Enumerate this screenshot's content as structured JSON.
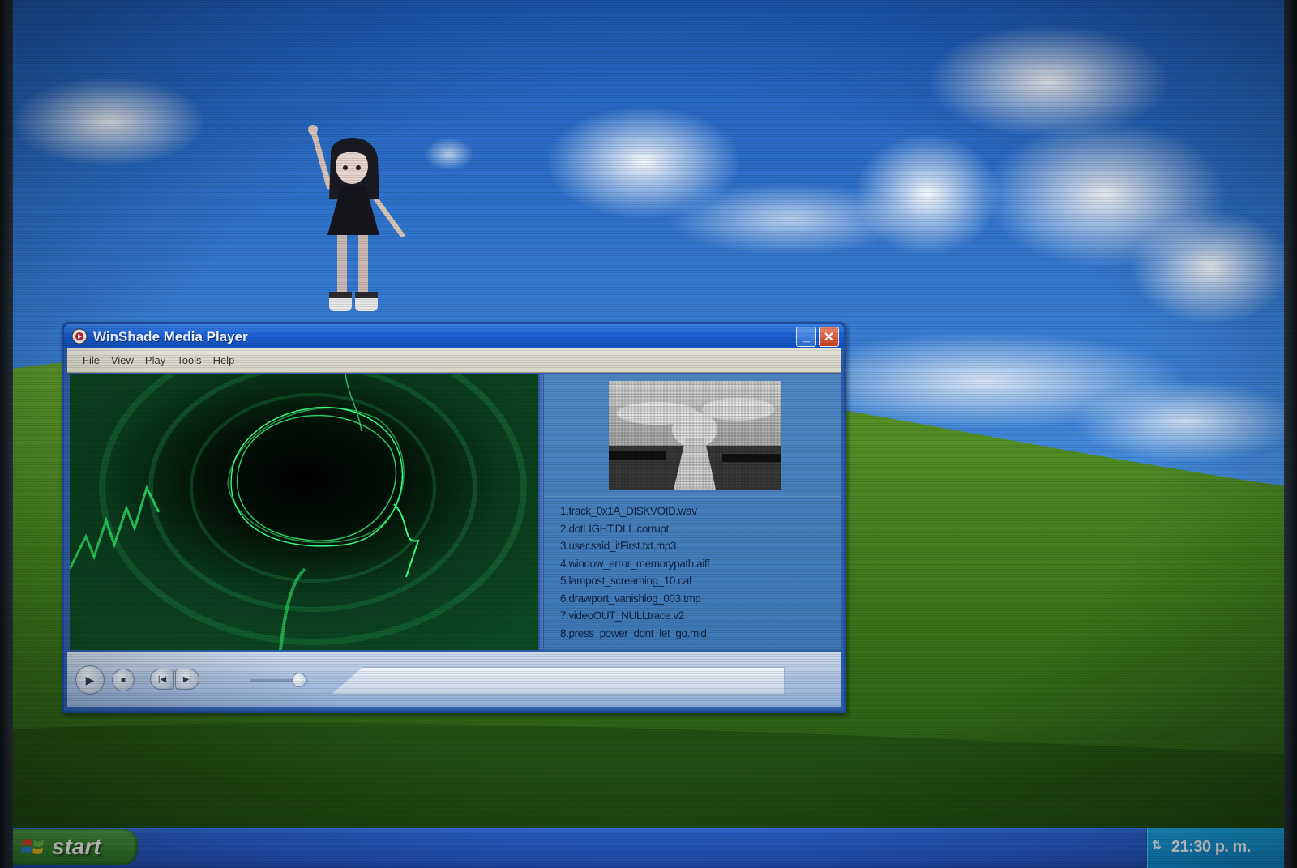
{
  "window": {
    "title": "WinShade Media Player",
    "minimize_label": "_",
    "close_label": "✕"
  },
  "menu": {
    "items": [
      "File",
      "View",
      "Play",
      "Tools",
      "Help"
    ]
  },
  "playlist": {
    "tracks": [
      "1.track_0x1A_DISKVOID.wav",
      "2.dotLIGHT.DLL.corrupt",
      "3.user.said_itFirst.txt.mp3",
      "4.window_error_memorypath.aiff",
      "5.lampost_screaming_10.caf",
      "6.drawport_vanishlog_003.tmp",
      "7.videoOUT_NULLtrace.v2",
      "8.press_power_dont_let_go.mid"
    ]
  },
  "controls": {
    "play_icon": "play-icon",
    "stop_icon": "stop-icon",
    "previous_icon": "previous-icon",
    "next_icon": "next-icon",
    "volume_level": 0.85
  },
  "taskbar": {
    "start_label": "start",
    "clock": "21:30 p. m.",
    "tray_icon": "network-icon"
  },
  "colors": {
    "title_bar": "#1a5fd3",
    "visualizer_green": "#2ee86a",
    "start_green": "#3b8c36",
    "tray_blue": "#1189d2"
  }
}
